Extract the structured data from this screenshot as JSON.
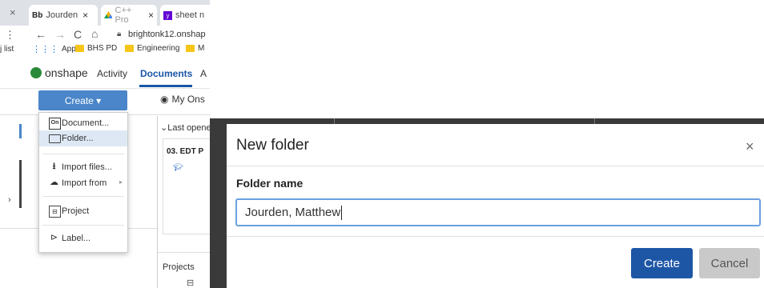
{
  "browser": {
    "tabs": [
      {
        "icon": "Bb",
        "label": "Jourden"
      },
      {
        "label": "C++ Pro"
      },
      {
        "label": "sheet n"
      }
    ],
    "address": "brightonk12.onshap",
    "bookmarks": [
      "Apps",
      "BHS PD",
      "Engineering",
      "M"
    ],
    "bookmarks_left": "j list"
  },
  "onshape": {
    "logo": "onshape",
    "nav": [
      "Activity",
      "Documents",
      "A"
    ],
    "create_label": "Create ▾",
    "my_onshape": "My Ons",
    "last_opened": "Last opene",
    "doc_card_title": "03. EDT P",
    "projects_label": "Projects"
  },
  "create_menu": {
    "items": [
      {
        "label": "Document...",
        "icon": "document-icon"
      },
      {
        "label": "Folder...",
        "icon": "folder-icon",
        "selected": true
      },
      {
        "label": "Import files...",
        "icon": "upload-icon"
      },
      {
        "label": "Import from",
        "icon": "cloud-upload-icon",
        "submenu": true
      },
      {
        "label": "Project",
        "icon": "project-icon"
      },
      {
        "label": "Label...",
        "icon": "label-icon"
      }
    ]
  },
  "dialog": {
    "title": "New folder",
    "close": "×",
    "field_label": "Folder name",
    "field_value": "Jourden, Matthew",
    "create_label": "Create",
    "cancel_label": "Cancel"
  },
  "colors": {
    "primary": "#1e56a6",
    "create_menu_button": "#4a86c9",
    "input_focus": "#6aa0e0"
  }
}
